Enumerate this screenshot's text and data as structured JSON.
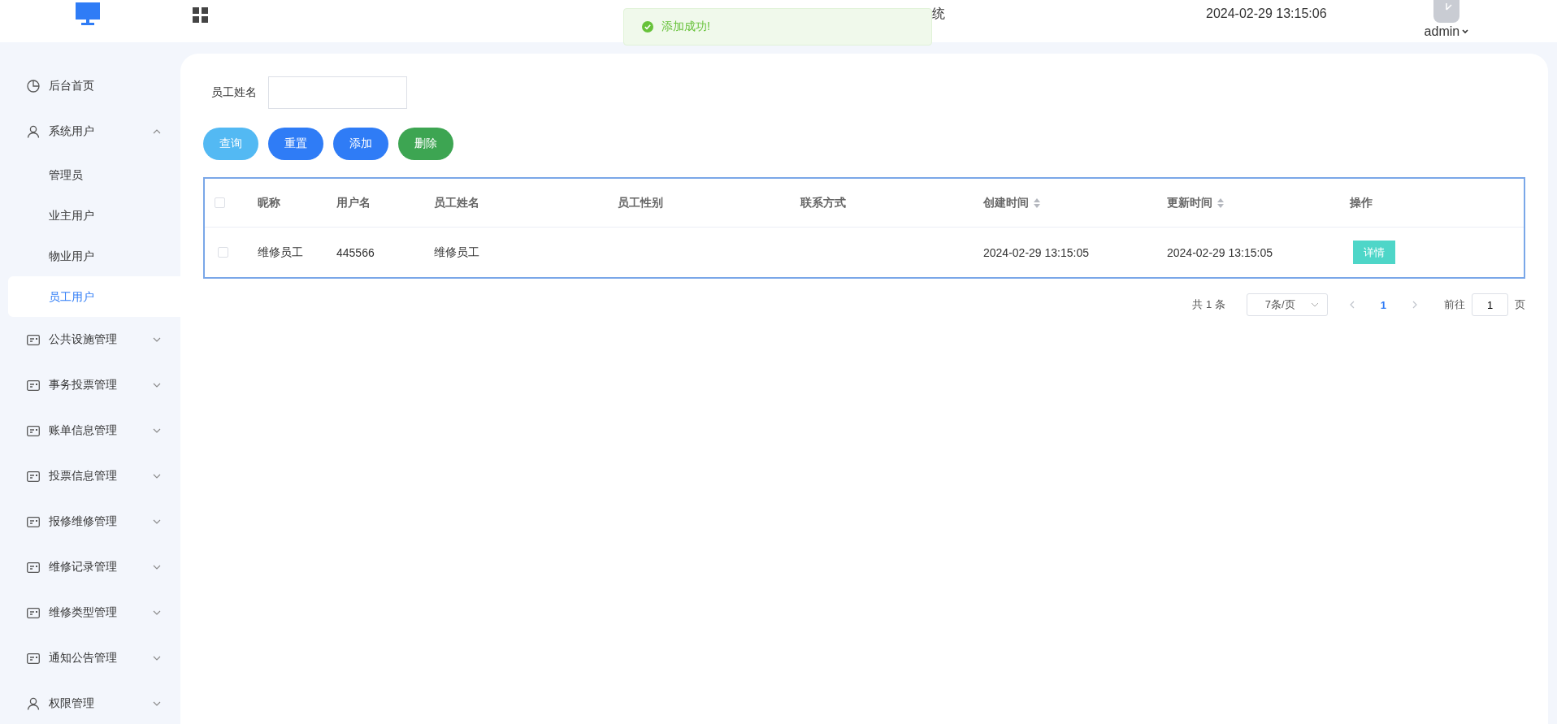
{
  "header": {
    "title_fragment": "统",
    "datetime": "2024-02-29 13:15:06",
    "user": "admin"
  },
  "toast": {
    "message": "添加成功!"
  },
  "sidebar": {
    "items": [
      {
        "label": "后台首页",
        "kind": "dashboard"
      },
      {
        "label": "系统用户",
        "kind": "users",
        "expanded": true,
        "children": [
          {
            "label": "管理员",
            "selected": false
          },
          {
            "label": "业主用户",
            "selected": false
          },
          {
            "label": "物业用户",
            "selected": false
          },
          {
            "label": "员工用户",
            "selected": true
          }
        ]
      },
      {
        "label": "公共设施管理",
        "kind": "module",
        "expanded": false
      },
      {
        "label": "事务投票管理",
        "kind": "module",
        "expanded": false
      },
      {
        "label": "账单信息管理",
        "kind": "module",
        "expanded": false
      },
      {
        "label": "投票信息管理",
        "kind": "module",
        "expanded": false
      },
      {
        "label": "报修维修管理",
        "kind": "module",
        "expanded": false
      },
      {
        "label": "维修记录管理",
        "kind": "module",
        "expanded": false
      },
      {
        "label": "维修类型管理",
        "kind": "module",
        "expanded": false
      },
      {
        "label": "通知公告管理",
        "kind": "module",
        "expanded": false
      },
      {
        "label": "权限管理",
        "kind": "users",
        "expanded": false
      }
    ]
  },
  "search": {
    "label": "员工姓名"
  },
  "buttons": [
    {
      "label": "查询",
      "kind": "query"
    },
    {
      "label": "重置",
      "kind": "primary"
    },
    {
      "label": "添加",
      "kind": "primary"
    },
    {
      "label": "删除",
      "kind": "danger"
    }
  ],
  "table": {
    "all_checked": false,
    "columns": [
      {
        "label": "昵称",
        "sortable": false
      },
      {
        "label": "用户名",
        "sortable": false
      },
      {
        "label": "员工姓名",
        "sortable": false
      },
      {
        "label": "员工性别",
        "sortable": false
      },
      {
        "label": "联系方式",
        "sortable": false
      },
      {
        "label": "创建时间",
        "sortable": true
      },
      {
        "label": "更新时间",
        "sortable": true
      },
      {
        "label": "操作",
        "sortable": false
      }
    ],
    "rows": [
      {
        "checked": false,
        "cells": [
          "维修员工",
          "445566",
          "维修员工",
          null,
          null,
          "2024-02-29 13:15:05",
          "2024-02-29 13:15:05"
        ],
        "action": "详情"
      }
    ]
  },
  "pagination": {
    "total": "共 1 条",
    "page_size": "7条/页",
    "pages": [
      {
        "label": "1",
        "selected": true
      }
    ],
    "goto_label": "前往",
    "goto_value": "1",
    "goto_suffix": "页"
  }
}
